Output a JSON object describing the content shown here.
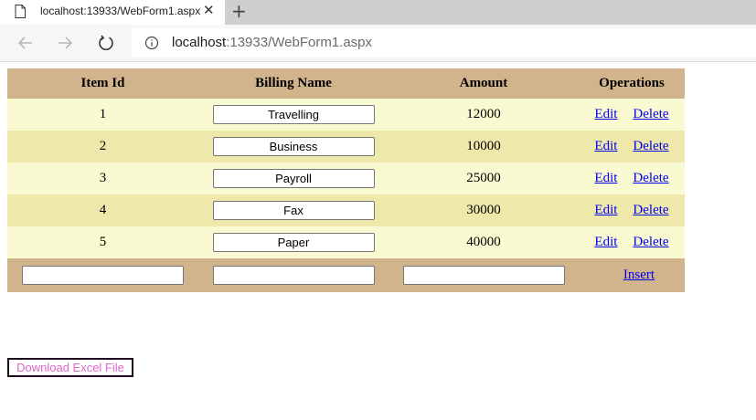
{
  "browser": {
    "tab_title": "localhost:13933/WebForm1.aspx",
    "new_tab_glyph": "+",
    "close_glyph": "✕",
    "url_host": "localhost",
    "url_port_path": ":13933/WebForm1.aspx",
    "icons": [
      "document-icon",
      "close-icon",
      "new-tab-icon",
      "back-arrow-icon",
      "forward-arrow-icon",
      "reload-icon",
      "info-icon"
    ]
  },
  "grid": {
    "headers": {
      "item_id": "Item Id",
      "billing_name": "Billing Name",
      "amount": "Amount",
      "operations": "Operations"
    },
    "rows": [
      {
        "item_id": "1",
        "billing_name": "Travelling",
        "amount": "12000",
        "edit": "Edit",
        "delete": "Delete"
      },
      {
        "item_id": "2",
        "billing_name": "Business",
        "amount": "10000",
        "edit": "Edit",
        "delete": "Delete"
      },
      {
        "item_id": "3",
        "billing_name": "Payroll",
        "amount": "25000",
        "edit": "Edit",
        "delete": "Delete"
      },
      {
        "item_id": "4",
        "billing_name": "Fax",
        "amount": "30000",
        "edit": "Edit",
        "delete": "Delete"
      },
      {
        "item_id": "5",
        "billing_name": "Paper",
        "amount": "40000",
        "edit": "Edit",
        "delete": "Delete"
      }
    ],
    "footer": {
      "new_item_id": "",
      "new_billing_name": "",
      "new_amount": "",
      "insert_label": "Insert"
    },
    "colors": {
      "header_bg": "#d2b48c",
      "row_odd_bg": "#fafad2",
      "row_even_bg": "#eee8aa",
      "link": "#0000ee"
    }
  },
  "download_button": {
    "label": "Download Excel File",
    "text_color": "#e066c8"
  }
}
